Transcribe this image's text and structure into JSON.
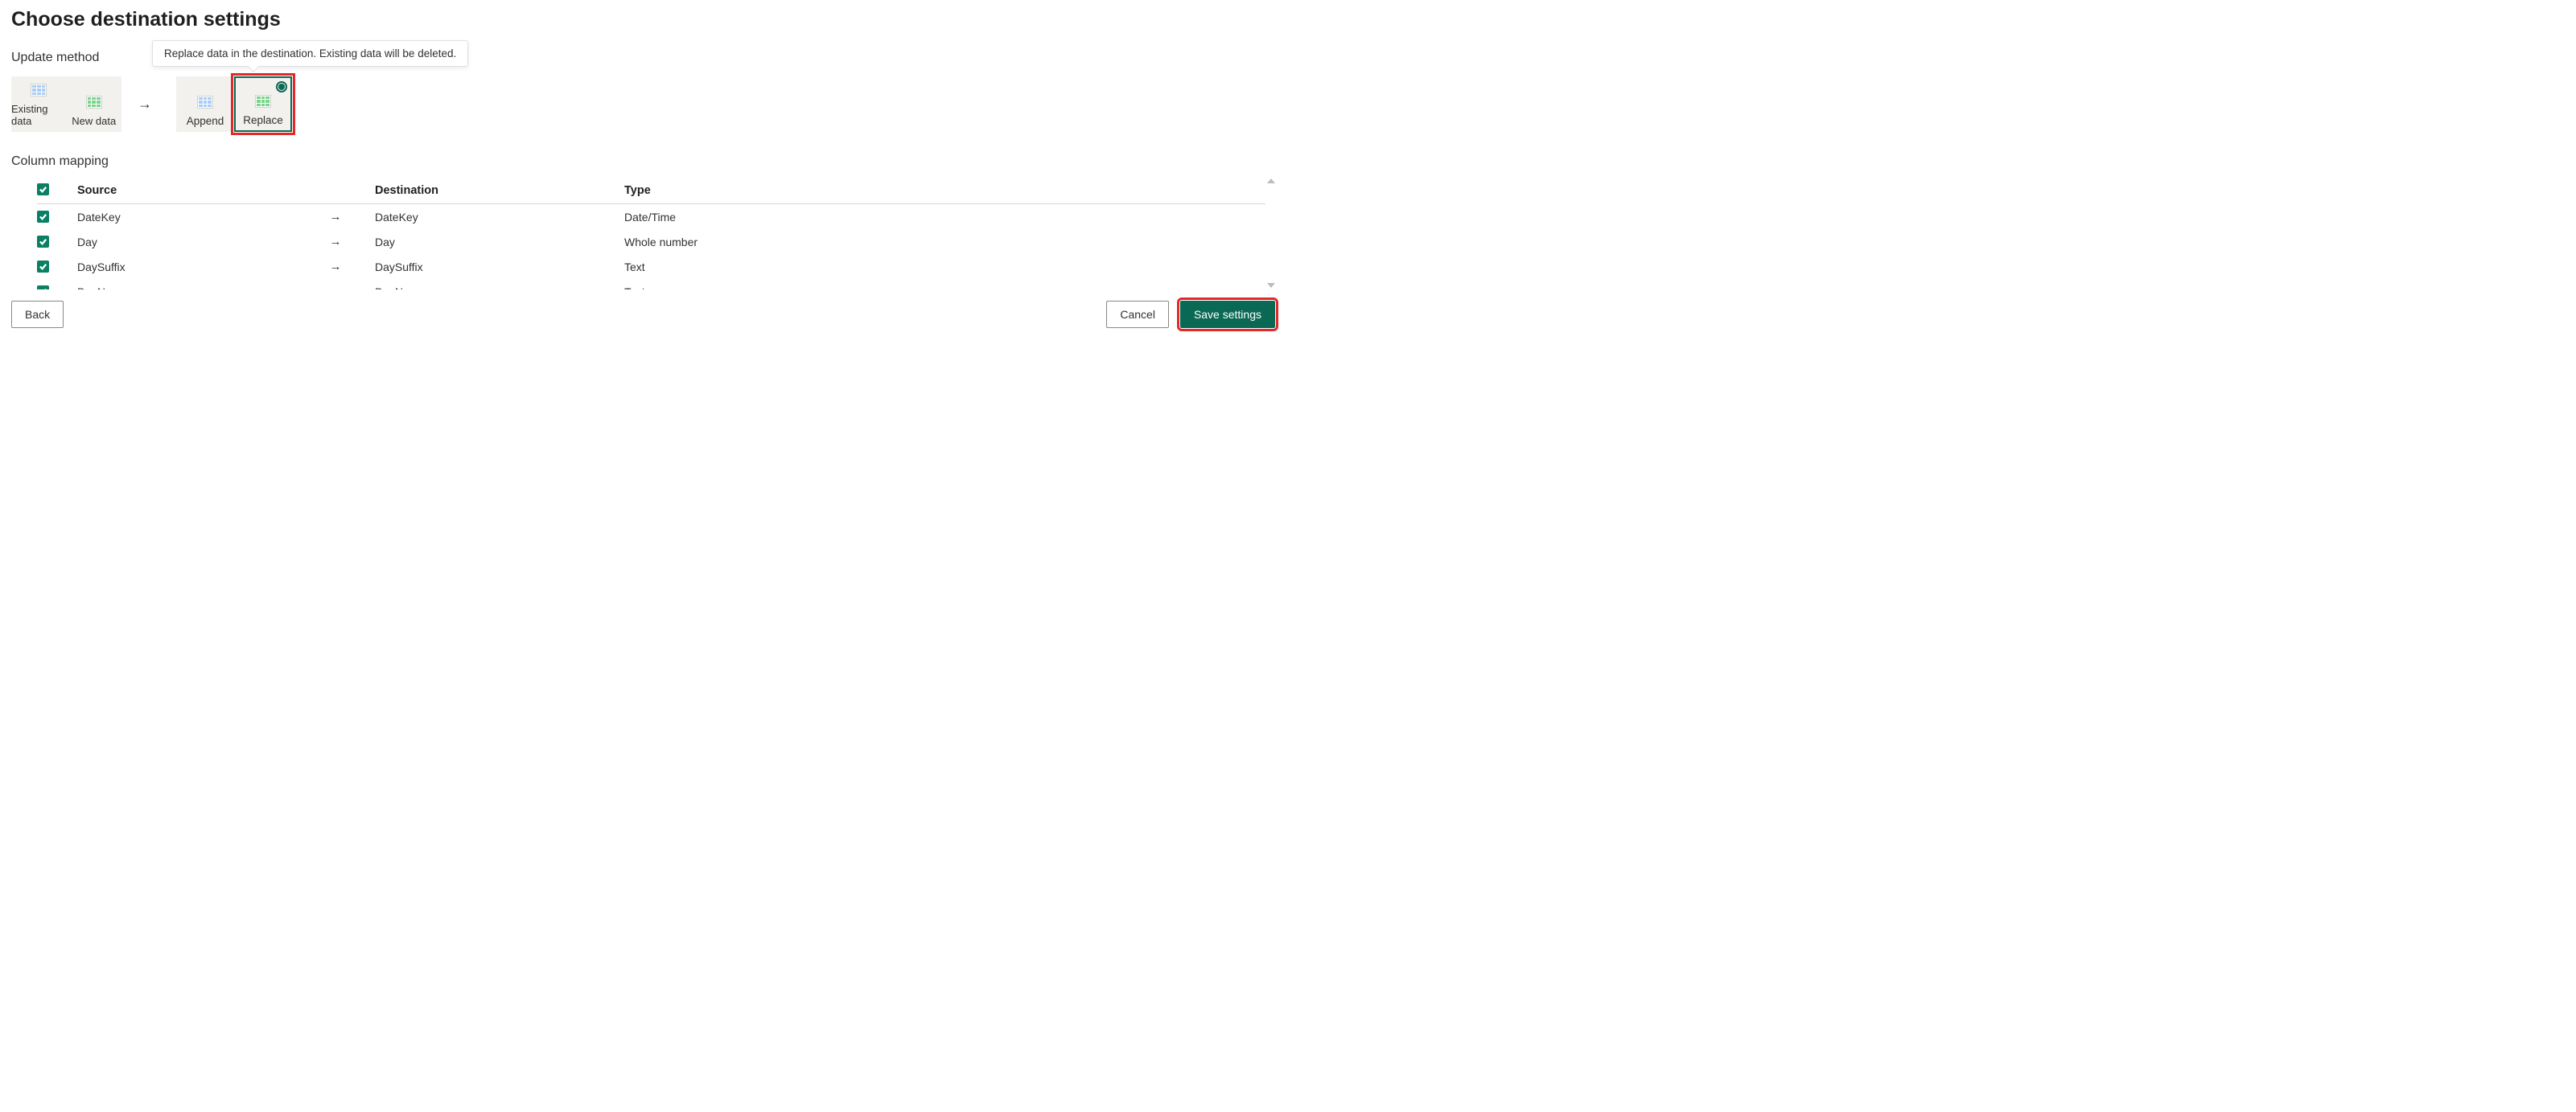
{
  "title": "Choose destination settings",
  "update_method": {
    "label": "Update method",
    "existing_label": "Existing data",
    "new_label": "New data",
    "options": {
      "append": "Append",
      "replace": "Replace"
    },
    "selected": "replace",
    "tooltip": "Replace data in the destination. Existing data will be deleted."
  },
  "column_mapping": {
    "label": "Column mapping",
    "headers": {
      "source": "Source",
      "destination": "Destination",
      "type": "Type"
    },
    "rows": [
      {
        "checked": true,
        "source": "DateKey",
        "destination": "DateKey",
        "type": "Date/Time"
      },
      {
        "checked": true,
        "source": "Day",
        "destination": "Day",
        "type": "Whole number"
      },
      {
        "checked": true,
        "source": "DaySuffix",
        "destination": "DaySuffix",
        "type": "Text"
      },
      {
        "checked": true,
        "source": "DayName",
        "destination": "DayName",
        "type": "Text"
      }
    ]
  },
  "footer": {
    "back": "Back",
    "cancel": "Cancel",
    "save": "Save settings"
  },
  "icons": {
    "existing": "table-blue-icon",
    "new": "table-green-icon",
    "append": "table-blue-icon",
    "replace": "table-green-icon"
  }
}
